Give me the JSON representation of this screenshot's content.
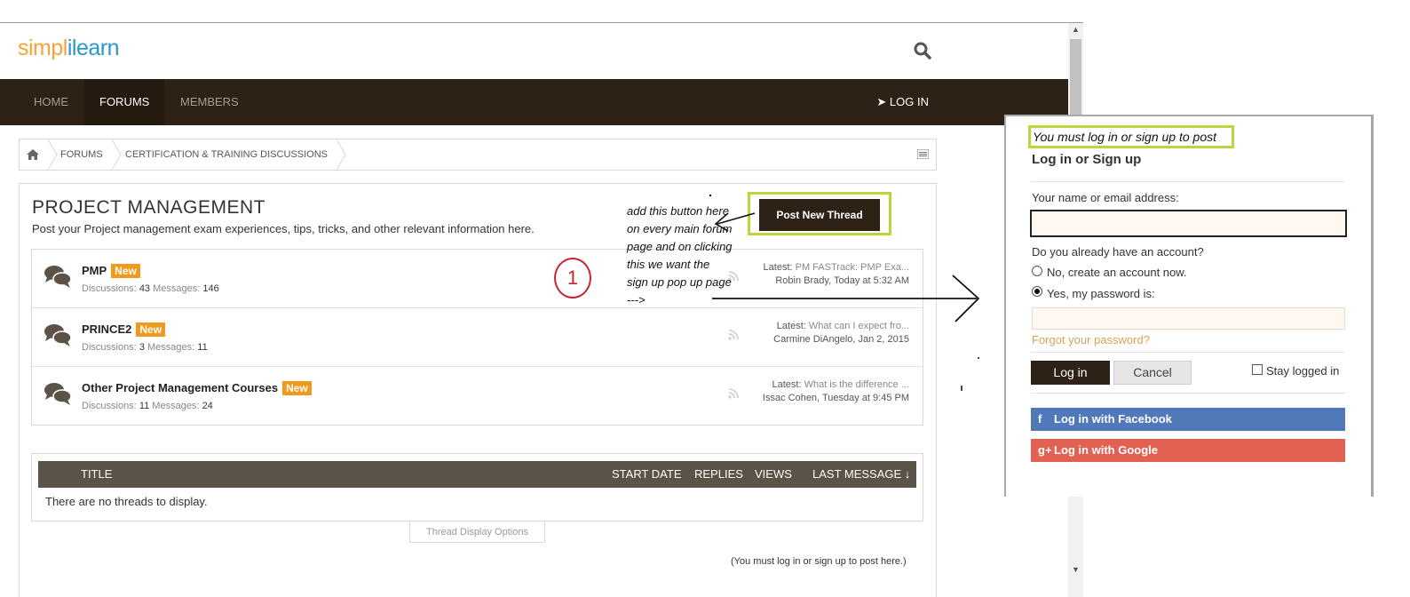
{
  "logo": {
    "part1": "simpl",
    "part2": "i",
    "part3": "learn"
  },
  "nav": {
    "items": [
      {
        "label": "HOME"
      },
      {
        "label": "FORUMS"
      },
      {
        "label": "MEMBERS"
      }
    ],
    "login_label": "LOG IN"
  },
  "breadcrumb": {
    "items": [
      "FORUMS",
      "CERTIFICATION & TRAINING DISCUSSIONS"
    ]
  },
  "page": {
    "title": "PROJECT MANAGEMENT",
    "description": "Post your Project management exam experiences, tips, tricks, and other relevant information here.",
    "post_button": "Post New Thread"
  },
  "forums": [
    {
      "name": "PMP",
      "badge": "New",
      "discussions_label": "Discussions:",
      "discussions": "43",
      "messages_label": "Messages:",
      "messages": "146",
      "latest_label": "Latest:",
      "latest_title": "PM FASTrack: PMP Exa...",
      "latest_meta": "Robin Brady, Today at 5:32 AM"
    },
    {
      "name": "PRINCE2",
      "badge": "New",
      "discussions_label": "Discussions:",
      "discussions": "3",
      "messages_label": "Messages:",
      "messages": "11",
      "latest_label": "Latest:",
      "latest_title": "What can I expect fro...",
      "latest_meta": "Carmine DiAngelo, Jan 2, 2015"
    },
    {
      "name": "Other Project Management Courses",
      "badge": "New",
      "discussions_label": "Discussions:",
      "discussions": "11",
      "messages_label": "Messages:",
      "messages": "24",
      "latest_label": "Latest:",
      "latest_title": "What is the difference ...",
      "latest_meta": "Issac Cohen, Tuesday at 9:45 PM"
    }
  ],
  "threads": {
    "columns": [
      "TITLE",
      "START DATE",
      "REPLIES",
      "VIEWS",
      "LAST MESSAGE ↓"
    ],
    "empty": "There are no threads to display.",
    "display_options": "Thread Display Options",
    "must_login": "(You must log in or sign up to post here.)"
  },
  "annotation": {
    "note": "add this button here on every main forum page and on clicking this we want the sign up pop up page --->",
    "circle_number": "1",
    "color": "#c8242f"
  },
  "popup": {
    "note": "You must log in or sign up to post",
    "title": "Log in or Sign up",
    "name_label": "Your name or email address:",
    "name_value": "",
    "account_question": "Do you already have an account?",
    "option_no": "No, create an account now.",
    "option_yes": "Yes, my password is:",
    "password_value": "",
    "forgot": "Forgot your password?",
    "login_button": "Log in",
    "cancel_button": "Cancel",
    "stay_logged_in": "Stay logged in",
    "facebook": "Log in with Facebook",
    "google": "Log in with Google"
  },
  "colors": {
    "nav_bg": "#2e2216",
    "badge": "#f29a1e",
    "highlight_outline": "#bcd53a",
    "facebook": "#4f79b9",
    "google": "#e26153"
  }
}
